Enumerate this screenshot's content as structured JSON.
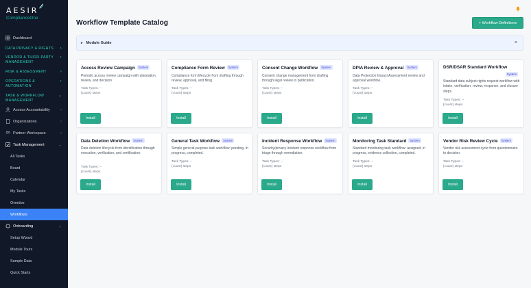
{
  "brand": {
    "name": "AESIR",
    "sub": "ComplianceOne"
  },
  "sidebar": {
    "dashboard": "Dashboard",
    "sections": {
      "privacy": "DATA PRIVACY & RIGHTS",
      "vendor_line1": "VENDOR & THIRD-PARTY",
      "vendor_line2": "MANAGEMENT",
      "risk": "RISK & ASSESSMENT",
      "ops_line1": "OPERATIONS &",
      "ops_line2": "AUTOMATION",
      "task_line1": "TASK & WORKFLOW",
      "task_line2": "MANAGEMENT"
    },
    "groups": {
      "access": "Access Accountability",
      "orgs": "Organizations",
      "partner": "Partner Workspace",
      "task_mgmt": "Task Management",
      "onboarding": "Onboarding"
    },
    "task_items": [
      "All Tasks",
      "Board",
      "Calendar",
      "My Tasks",
      "Overdue",
      "Workflows"
    ],
    "onboarding_items": [
      "Setup Wizard",
      "Module Tours",
      "Sample Data",
      "Quick Starts"
    ]
  },
  "header": {
    "title": "Workflow Template Catalog",
    "definitions_button": "+ Workflow Definitions"
  },
  "guide": {
    "label": "Module Guide",
    "close": "×",
    "toggle": "▸"
  },
  "cards": [
    {
      "title": "Access Review Campaign",
      "badge": "System",
      "desc": "Periodic access review campaign with attestation, review, and decision.",
      "task_types": "Task Types: –",
      "steps": "{count} steps",
      "install": "Install"
    },
    {
      "title": "Compliance Form Review",
      "badge": "System",
      "desc": "Compliance form lifecycle from drafting through review, approval, and filing.",
      "task_types": "Task Types: –",
      "steps": "{count} steps",
      "install": "Install"
    },
    {
      "title": "Consent Change Workflow",
      "badge": "System",
      "desc": "Consent change management from drafting through legal review to publication.",
      "task_types": "Task Types: –",
      "steps": "{count} steps",
      "install": "Install"
    },
    {
      "title": "DPIA Review & Approval",
      "badge": "System",
      "desc": "Data Protection Impact Assessment review and approval workflow.",
      "task_types": "Task Types: –",
      "steps": "{count} steps",
      "install": "Install"
    },
    {
      "title": "DSR/DSAR Standard Workflow",
      "badge": "System",
      "desc": "Standard data subject rights request workflow with intake, verification, review, response, and closure steps.",
      "task_types": "Task Types: –",
      "steps": "{count} steps",
      "install": "Install"
    },
    {
      "title": "Data Deletion Workflow",
      "badge": "System",
      "desc": "Data deletion lifecycle from identification through execution, verification, and certification.",
      "task_types": "Task Types: –",
      "steps": "{count} steps",
      "install": "Install"
    },
    {
      "title": "General Task Workflow",
      "badge": "System",
      "desc": "Simple general-purpose task workflow: pending, in progress, completed.",
      "task_types": "Task Types: –",
      "steps": "{count} steps",
      "install": "Install"
    },
    {
      "title": "Incident Response Workflow",
      "badge": "System",
      "desc": "Security/privacy incident response workflow from triage through remediation.",
      "task_types": "Task Types: –",
      "steps": "{count} steps",
      "install": "Install"
    },
    {
      "title": "Monitoring Task Standard",
      "badge": "System",
      "desc": "Standard monitoring task workflow: assigned, in progress, evidence collection, completed.",
      "task_types": "Task Types: –",
      "steps": "{count} steps",
      "install": "Install"
    },
    {
      "title": "Vendor Risk Review Cycle",
      "badge": "System",
      "desc": "Vendor risk assessment cycle from questionnaire to decision.",
      "task_types": "Task Types: –",
      "steps": "{count} steps",
      "install": "Install"
    }
  ],
  "colors": {
    "sidebar_bg": "#111827",
    "accent": "#2aa98b",
    "section_text": "#2dd4bf",
    "active_item": "#3b82f6",
    "badge_bg": "#e0e7ff"
  }
}
